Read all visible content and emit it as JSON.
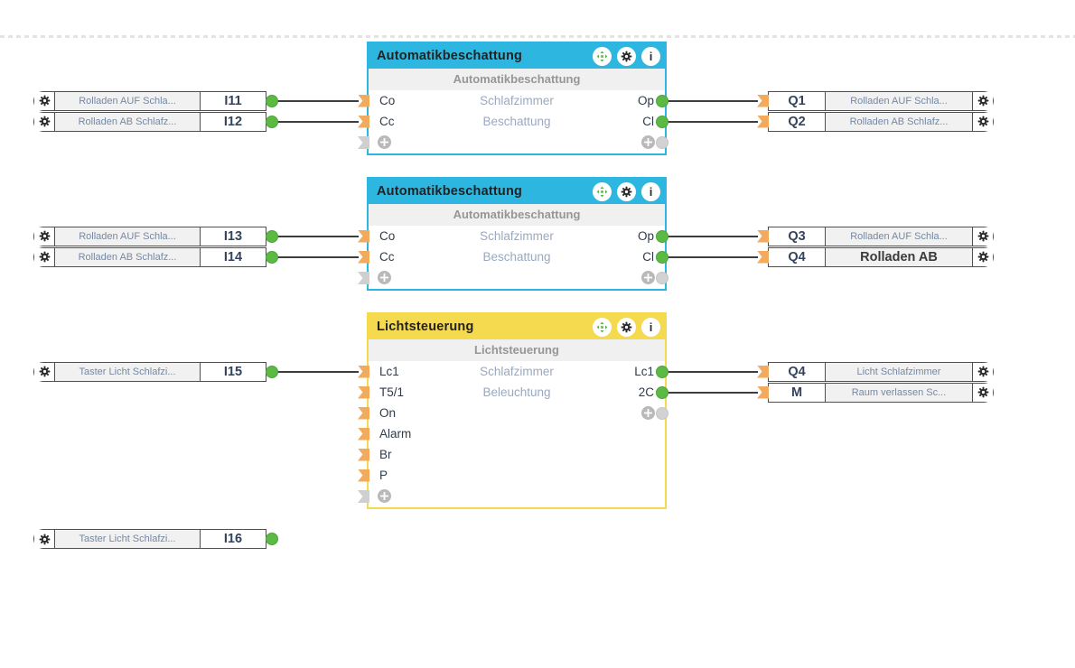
{
  "palette": {
    "blue": "#2db7e0",
    "yellow": "#f5d94f",
    "green": "#5cb944",
    "orange": "#f2ab5c",
    "gray": "#cfcfcf",
    "wire": "#3d3d3d"
  },
  "header_icons": [
    {
      "name": "move-icon"
    },
    {
      "name": "gear-icon"
    },
    {
      "name": "info-icon",
      "glyph": "i"
    }
  ],
  "groups": [
    {
      "block": {
        "title": "Automatikbeschattung",
        "subtitle": "Automatikbeschattung",
        "color_key": "blue",
        "rows": [
          {
            "in": "Co",
            "center": "Schlafzimmer",
            "out": "Op"
          },
          {
            "in": "Cc",
            "center": "Beschattung",
            "out": "Cl"
          }
        ]
      },
      "left_pills": [
        {
          "id": "I11",
          "label": "Rolladen AUF Schla...",
          "row": 0
        },
        {
          "id": "I12",
          "label": "Rolladen AB Schlafz...",
          "row": 1
        }
      ],
      "right_pills": [
        {
          "id": "Q1",
          "label": "Rolladen AUF Schla...",
          "row": 0
        },
        {
          "id": "Q2",
          "label": "Rolladen AB Schlafz...",
          "row": 1
        }
      ]
    },
    {
      "block": {
        "title": "Automatikbeschattung",
        "subtitle": "Automatikbeschattung",
        "color_key": "blue",
        "rows": [
          {
            "in": "Co",
            "center": "Schlafzimmer",
            "out": "Op"
          },
          {
            "in": "Cc",
            "center": "Beschattung",
            "out": "Cl"
          }
        ]
      },
      "left_pills": [
        {
          "id": "I13",
          "label": "Rolladen AUF Schla...",
          "row": 0
        },
        {
          "id": "I14",
          "label": "Rolladen AB Schlafz...",
          "row": 1
        }
      ],
      "right_pills": [
        {
          "id": "Q3",
          "label": "Rolladen AUF Schla...",
          "row": 0
        },
        {
          "id": "Q4",
          "label": "Rolladen AB",
          "row": 1,
          "emphasis": true
        }
      ]
    },
    {
      "block": {
        "title": "Lichtsteuerung",
        "subtitle": "Lichtsteuerung",
        "color_key": "yellow",
        "rows": [
          {
            "in": "Lc1",
            "center": "Schlafzimmer",
            "out": "Lc1"
          },
          {
            "in": "T5/1",
            "center": "Beleuchtung",
            "out": "2C"
          },
          {
            "in": "On"
          },
          {
            "in": "Alarm"
          },
          {
            "in": "Br"
          },
          {
            "in": "P"
          }
        ]
      },
      "left_pills": [
        {
          "id": "I15",
          "label": "Taster Licht Schlafzi...",
          "row": 0
        }
      ],
      "right_pills": [
        {
          "id": "Q4",
          "label": "Licht Schlafzimmer",
          "row": 0
        },
        {
          "id": "M",
          "label": "Raum verlassen Sc...",
          "row": 1
        }
      ]
    }
  ],
  "standalone_inputs": [
    {
      "id": "I16",
      "label": "Taster Licht Schlafzi..."
    }
  ]
}
